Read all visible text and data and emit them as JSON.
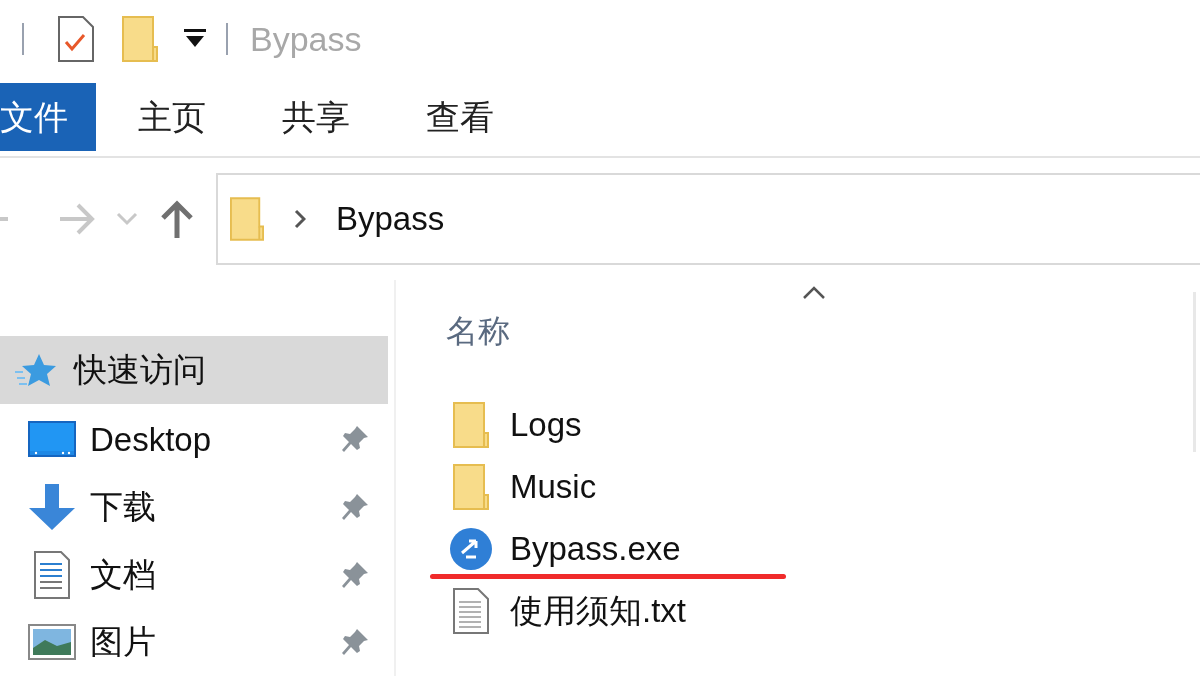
{
  "window": {
    "title": "Bypass"
  },
  "ribbon_tabs": [
    {
      "label": "文件",
      "selected": true
    },
    {
      "label": "主页",
      "selected": false
    },
    {
      "label": "共享",
      "selected": false
    },
    {
      "label": "查看",
      "selected": false
    }
  ],
  "address_bar": {
    "path": [
      "Bypass"
    ]
  },
  "sidebar": {
    "items": [
      {
        "kind": "star",
        "label": "快速访问",
        "selected": true,
        "pinned": false
      },
      {
        "kind": "desktop",
        "label": "Desktop",
        "selected": false,
        "pinned": true
      },
      {
        "kind": "download",
        "label": "下载",
        "selected": false,
        "pinned": true
      },
      {
        "kind": "document",
        "label": "文档",
        "selected": false,
        "pinned": true
      },
      {
        "kind": "picture",
        "label": "图片",
        "selected": false,
        "pinned": true
      }
    ]
  },
  "file_list": {
    "column": "名称",
    "files": [
      {
        "kind": "folder",
        "name": "Logs",
        "underlined": false
      },
      {
        "kind": "folder",
        "name": "Music",
        "underlined": false
      },
      {
        "kind": "exe",
        "name": "Bypass.exe",
        "underlined": true
      },
      {
        "kind": "txt",
        "name": "使用须知.txt",
        "underlined": false
      }
    ]
  }
}
